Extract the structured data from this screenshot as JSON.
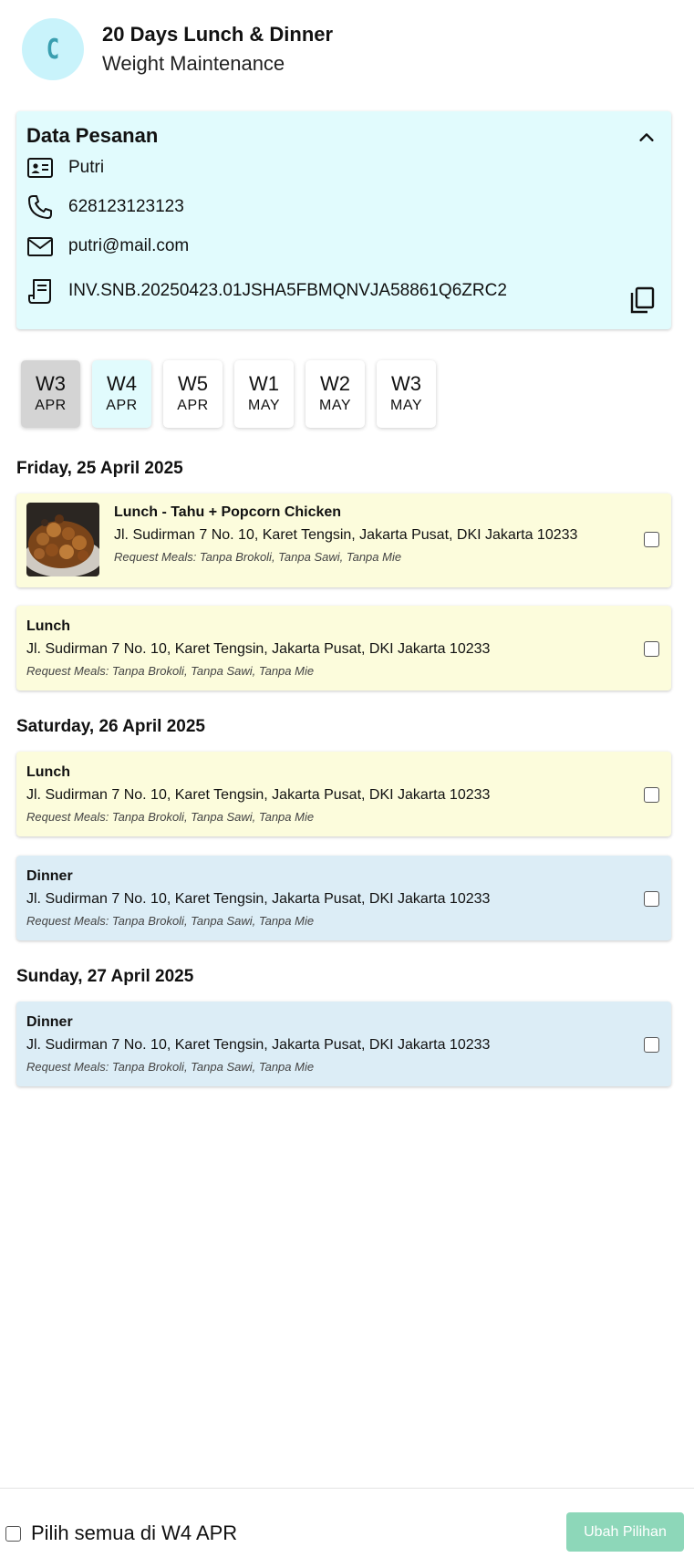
{
  "header": {
    "avatar_letter": "C",
    "title": "20 Days Lunch & Dinner",
    "subtitle": "Weight Maintenance"
  },
  "order": {
    "title": "Data Pesanan",
    "name": "Putri",
    "phone": "628123123123",
    "email": "putri@mail.com",
    "invoice": "INV.SNB.20250423.01JSHA5FBMQNVJA58861Q6ZRC2"
  },
  "weeks": [
    {
      "week": "W3",
      "month": "APR"
    },
    {
      "week": "W4",
      "month": "APR"
    },
    {
      "week": "W5",
      "month": "APR"
    },
    {
      "week": "W1",
      "month": "MAY"
    },
    {
      "week": "W2",
      "month": "MAY"
    },
    {
      "week": "W3",
      "month": "MAY"
    }
  ],
  "days": [
    {
      "date": "Friday, 25 April 2025",
      "meals": [
        {
          "title": "Lunch - Tahu + Popcorn Chicken",
          "address": "Jl. Sudirman 7 No. 10, Karet Tengsin, Jakarta Pusat, DKI Jakarta 10233",
          "request": "Request Meals: Tanpa Brokoli, Tanpa Sawi, Tanpa Mie",
          "has_image": true
        },
        {
          "title": "Lunch",
          "address": "Jl. Sudirman 7 No. 10, Karet Tengsin, Jakarta Pusat, DKI Jakarta 10233",
          "request": "Request Meals: Tanpa Brokoli, Tanpa Sawi, Tanpa Mie"
        }
      ]
    },
    {
      "date": "Saturday, 26 April 2025",
      "meals": [
        {
          "title": "Lunch",
          "address": "Jl. Sudirman 7 No. 10, Karet Tengsin, Jakarta Pusat, DKI Jakarta 10233",
          "request": "Request Meals: Tanpa Brokoli, Tanpa Sawi, Tanpa Mie"
        },
        {
          "title": "Dinner",
          "address": "Jl. Sudirman 7 No. 10, Karet Tengsin, Jakarta Pusat, DKI Jakarta 10233",
          "request": "Request Meals: Tanpa Brokoli, Tanpa Sawi, Tanpa Mie"
        }
      ]
    },
    {
      "date": "Sunday, 27 April 2025",
      "meals": [
        {
          "title": "Dinner",
          "address": "Jl. Sudirman 7 No. 10, Karet Tengsin, Jakarta Pusat, DKI Jakarta 10233",
          "request": "Request Meals: Tanpa Brokoli, Tanpa Sawi, Tanpa Mie"
        }
      ]
    }
  ],
  "footer": {
    "select_all_label": "Pilih semua di W4 APR",
    "button_label": "Ubah Pilihan"
  },
  "colors": {
    "accent_cyan": "#e1fbfd",
    "lunch_bg": "#fcfcdc",
    "dinner_bg": "#dcedf6",
    "button_green": "#8dd7b9"
  }
}
